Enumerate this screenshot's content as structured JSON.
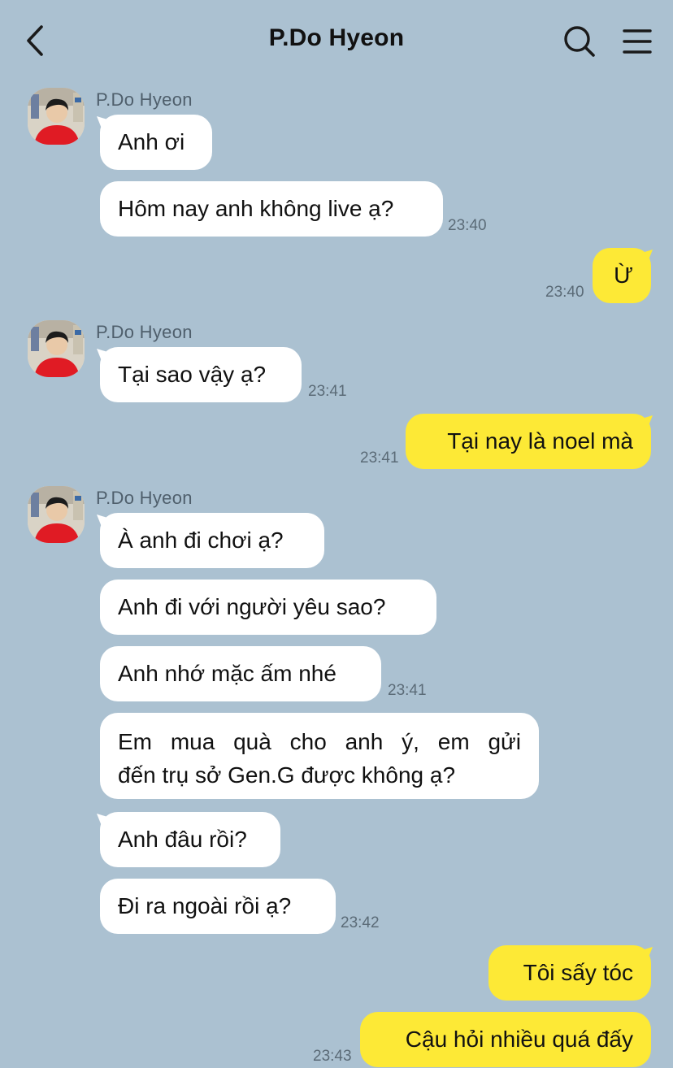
{
  "header": {
    "title": "P.Do Hyeon"
  },
  "messages": [
    {
      "sender": "P.Do Hyeon",
      "text": "Anh ơi"
    },
    {
      "text": "Hôm nay anh không live ạ?",
      "time": "23:40"
    },
    {
      "text": "Ừ",
      "time": "23:40"
    },
    {
      "sender": "P.Do Hyeon",
      "text": "Tại sao vậy ạ?",
      "time": "23:41"
    },
    {
      "text": "Tại nay là noel mà",
      "time": "23:41"
    },
    {
      "sender": "P.Do Hyeon",
      "text": "À anh đi chơi ạ?"
    },
    {
      "text": "Anh đi với người yêu sao?"
    },
    {
      "text": "Anh nhớ mặc ấm nhé",
      "time": "23:41"
    },
    {
      "line1": "Em mua quà cho anh ý, em gửi",
      "line2": "đến trụ sở Gen.G được không ạ?"
    },
    {
      "text": "Anh đâu rồi?"
    },
    {
      "text": "Đi ra ngoài rồi ạ?",
      "time": "23:42"
    },
    {
      "text": "Tôi sấy tóc"
    },
    {
      "text": "Cậu hỏi nhiều quá đấy",
      "time": "23:43"
    }
  ],
  "colors": {
    "background": "#abc1d1",
    "incoming_bubble": "#ffffff",
    "outgoing_bubble": "#fde936"
  },
  "icons": [
    "chevron-left-icon",
    "search-icon",
    "menu-icon",
    "avatar-photo"
  ]
}
